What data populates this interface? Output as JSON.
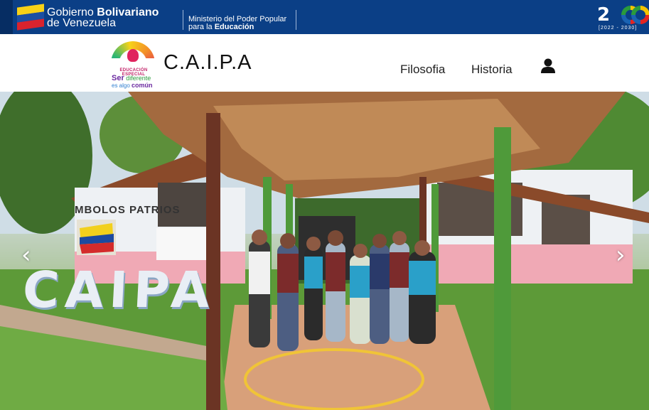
{
  "gov_bar": {
    "gov_line1_prefix": "Gobierno ",
    "gov_line1_bold": "Bolivariano",
    "gov_line2": "de Venezuela",
    "ministry_line1": "Ministerio del Poder Popular",
    "ministry_line2_prefix": "para la ",
    "ministry_line2_bold": "Educación",
    "bicentennial_number": "2",
    "bicentennial_years": "[2022 - 2030]",
    "flag_colors": [
      "#f7d117",
      "#1b4fa3",
      "#d9232e"
    ]
  },
  "navbar": {
    "logo": {
      "line1": "EDUCACIÓN ESPECIAL",
      "line2_bold": "Ser",
      "line2_rest": " diferente",
      "line3_prefix": "es algo ",
      "line3_bold": "común"
    },
    "site_title": "C.A.I.P.A",
    "links": [
      "Filosofia",
      "Historia"
    ],
    "user_icon": "user-icon"
  },
  "hero": {
    "mural_text": "MBOLOS PATRIOS",
    "sign_letters": "CAIPA",
    "prev_arrow": "‹",
    "next_arrow": "›"
  }
}
